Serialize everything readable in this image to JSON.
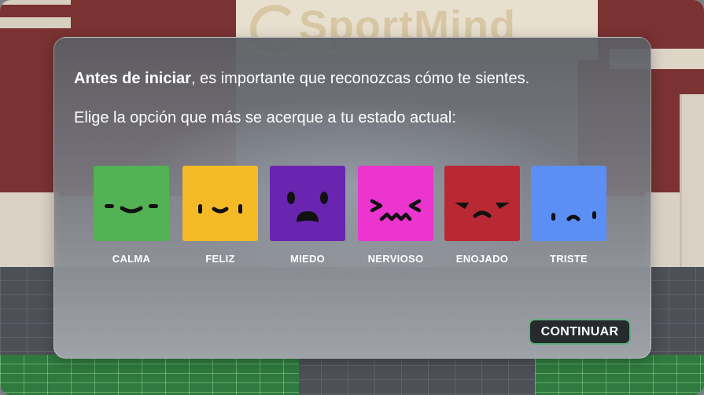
{
  "background": {
    "sign_text": "SportMind"
  },
  "dialog": {
    "intro_bold": "Antes de iniciar",
    "intro_rest": ", es importante que reconozcas cómo te sientes.",
    "instruction": "Elige la opción que más se acerque a tu estado actual:",
    "continue_label": "CONTINUAR"
  },
  "emotions": [
    {
      "label": "CALMA",
      "color": "#53b253",
      "icon": "calm-face-icon"
    },
    {
      "label": "FELIZ",
      "color": "#f5bb26",
      "icon": "happy-face-icon"
    },
    {
      "label": "MIEDO",
      "color": "#6a25b0",
      "icon": "scared-face-icon"
    },
    {
      "label": "NERVIOSO",
      "color": "#ec35cf",
      "icon": "nervous-face-icon"
    },
    {
      "label": "ENOJADO",
      "color": "#b92933",
      "icon": "angry-face-icon"
    },
    {
      "label": "TRISTE",
      "color": "#5c8ff5",
      "icon": "sad-face-icon"
    }
  ]
}
